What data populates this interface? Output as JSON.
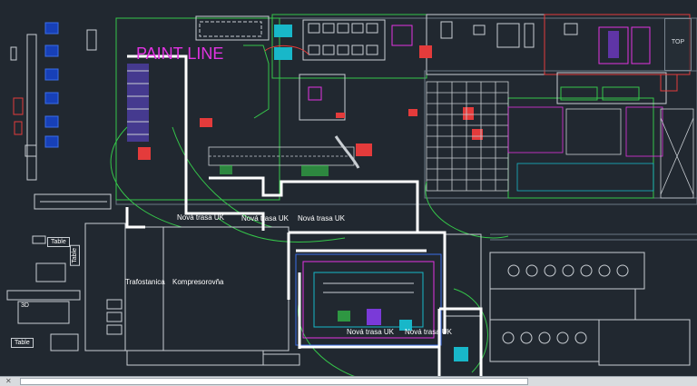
{
  "drawing": {
    "title_main": "PAINT LINE",
    "route_label": "Nová trasa UK",
    "labels": {
      "trafostanica": "Trafostanica",
      "kompresorovna": "Kompresorovňa",
      "table_top": "Table",
      "table_side": "Table",
      "table_bottom": "Table",
      "three_d": "3D"
    }
  },
  "viewcube": {
    "top_label": "TOP"
  },
  "command_line": {
    "placeholder": ""
  },
  "colors": {
    "background": "#212830",
    "route": "#ffffff",
    "paint_line_text": "#e233e2"
  }
}
